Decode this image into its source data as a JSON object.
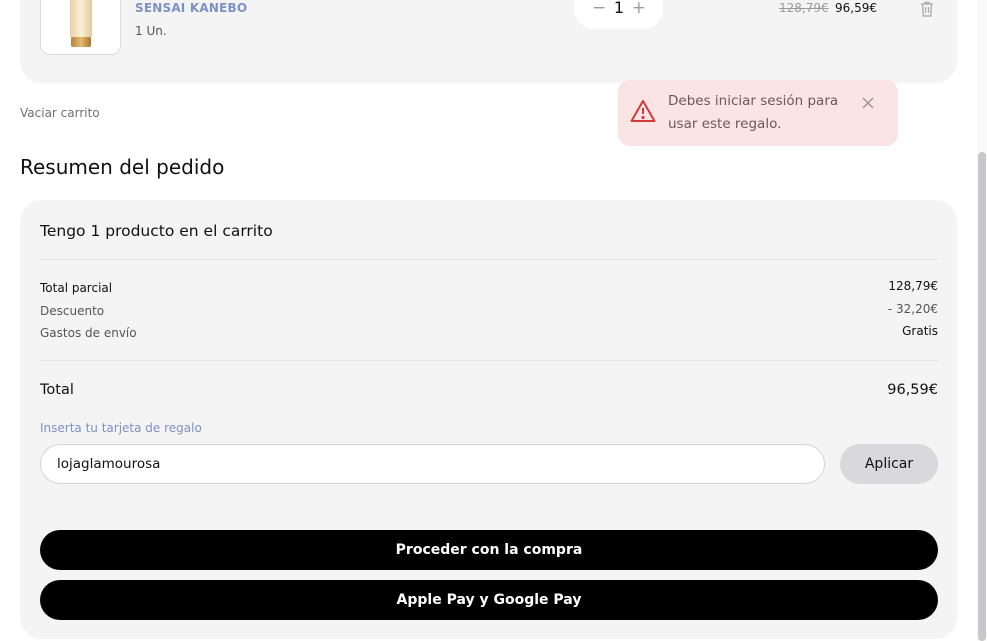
{
  "cart_item": {
    "brand": "SENSAI KANEBO",
    "units": "1 Un.",
    "quantity": "1",
    "minus_symbol": "−",
    "plus_symbol": "+",
    "old_price": "128,79€",
    "new_price": "96,59€",
    "delete_icon": "trash-icon"
  },
  "empty_cart_label": "Vaciar carrito",
  "toast": {
    "message": "Debes iniciar sesión para usar este regalo.",
    "icon": "warning-triangle-icon",
    "close_icon": "close-icon",
    "colors": {
      "background": "#fbe4e4",
      "icon": "#d23a3a"
    }
  },
  "summary": {
    "title": "Resumen del pedido",
    "count_text": "Tengo 1 producto en el carrito",
    "rows": [
      {
        "label": "Total parcial",
        "value": "128,79€"
      },
      {
        "label": "Descuento",
        "value": "- 32,20€"
      },
      {
        "label": "Gastos de envío",
        "value": "Gratis"
      }
    ],
    "total_label": "Total",
    "total_value": "96,59€",
    "gift_label": "Inserta tu tarjeta de regalo",
    "gift_value": "lojaglamourosa",
    "apply_label": "Aplicar",
    "checkout_label": "Proceder con la compra",
    "wallet_label": "Apple Pay y Google Pay"
  },
  "colors": {
    "accent": "#7d91c6",
    "card": "#f4f4f5",
    "button": "#000000"
  }
}
